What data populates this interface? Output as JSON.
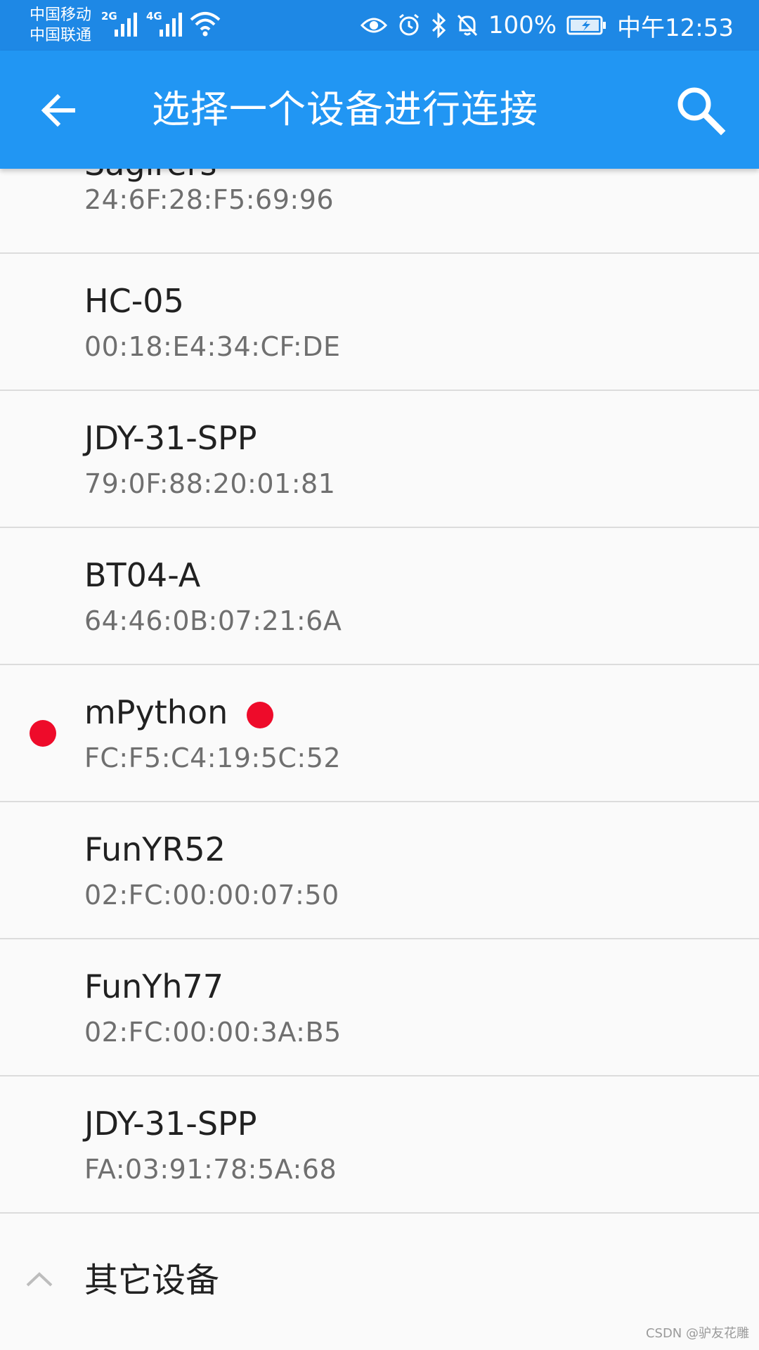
{
  "status_bar": {
    "carrier_1": "中国移动",
    "carrier_2": "中国联通",
    "net_1": "2G",
    "net_2": "4G",
    "battery": "100%",
    "time": "中午12:53",
    "icons": [
      "eye-icon",
      "alarm-icon",
      "bluetooth-icon",
      "mute-icon",
      "battery-charging-icon"
    ]
  },
  "app_bar": {
    "title": "选择一个设备进行连接",
    "back_icon": "arrow-left-icon",
    "search_icon": "search-icon",
    "color": "#2196f3"
  },
  "devices": [
    {
      "name": "Sagirers",
      "address": "24:6F:28:F5:69:96"
    },
    {
      "name": "HC-05",
      "address": "00:18:E4:34:CF:DE"
    },
    {
      "name": "JDY-31-SPP",
      "address": "79:0F:88:20:01:81"
    },
    {
      "name": "BT04-A",
      "address": "64:46:0B:07:21:6A"
    },
    {
      "name": "mPython",
      "address": "FC:F5:C4:19:5C:52"
    },
    {
      "name": "FunYR52",
      "address": "02:FC:00:00:07:50"
    },
    {
      "name": "FunYh77",
      "address": "02:FC:00:00:3A:B5"
    },
    {
      "name": "JDY-31-SPP",
      "address": "FA:03:91:78:5A:68"
    }
  ],
  "other_devices": {
    "title": "其它设备",
    "icon": "chevron-up-icon"
  },
  "marker_color": "#ee0b2a",
  "watermark": "CSDN @驴友花雕"
}
